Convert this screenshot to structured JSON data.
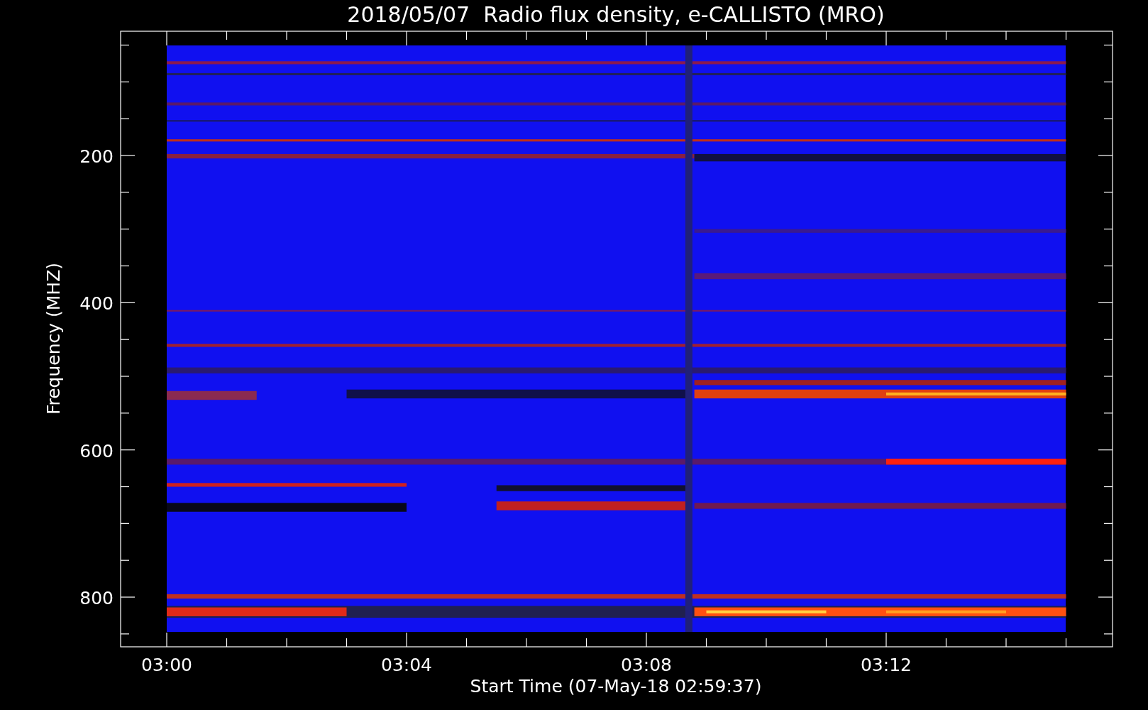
{
  "title": "2018/05/07  Radio flux density, e-CALLISTO (MRO)",
  "y_axis": {
    "label": "Frequency (MHZ)",
    "ticks": [
      "200",
      "400",
      "600",
      "800"
    ]
  },
  "x_axis": {
    "label": "Start Time (07-May-18 02:59:37)",
    "ticks": [
      "03:00",
      "03:04",
      "03:08",
      "03:12"
    ]
  }
}
